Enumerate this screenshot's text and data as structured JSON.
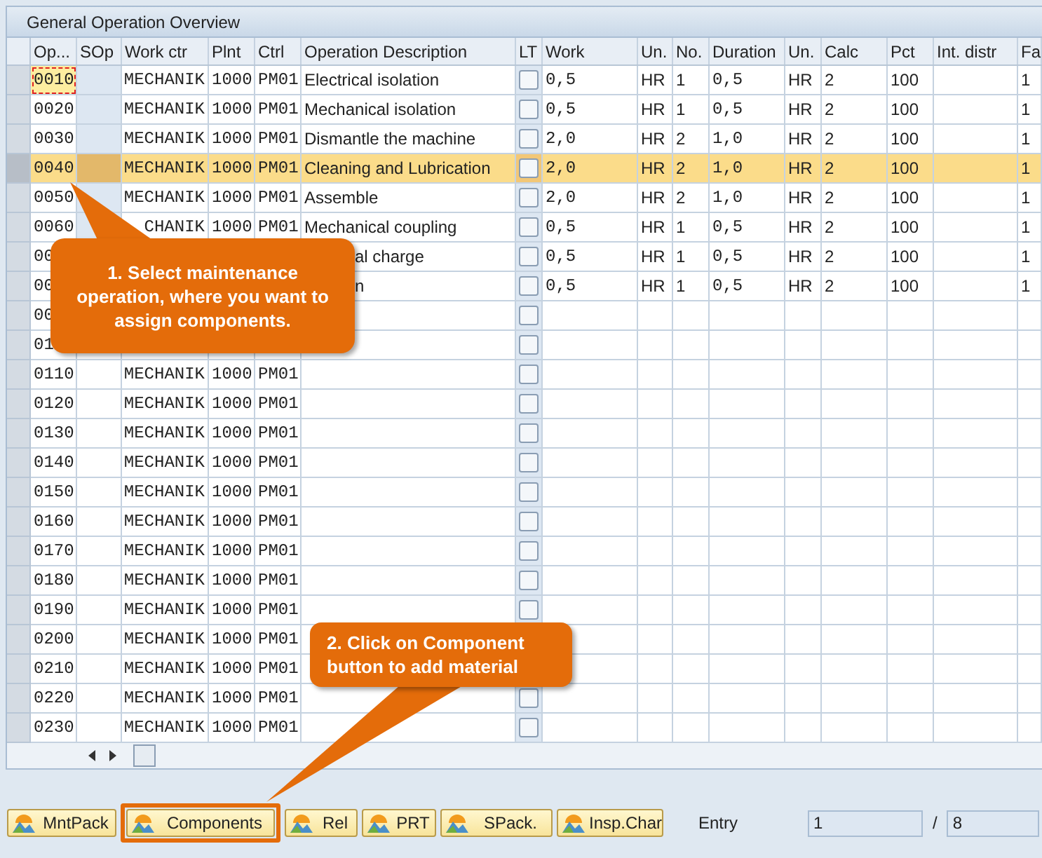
{
  "panel": {
    "title": "General Operation Overview"
  },
  "table": {
    "columns": [
      "Op...",
      "SOp",
      "Work ctr",
      "Plnt",
      "Ctrl",
      "Operation Description",
      "LT",
      "Work",
      "Un.",
      "No.",
      "Duration",
      "Un.",
      "Calc",
      "Pct",
      "Int. distr",
      "Fa"
    ],
    "rows": [
      {
        "selected": false,
        "focused": true,
        "covered": false,
        "lt_checked": false,
        "cells": [
          "0010",
          null,
          "MECHANIK",
          "1000",
          "PM01",
          "Electrical isolation",
          null,
          "0,5",
          "HR",
          "1",
          "0,5",
          "HR",
          "2",
          "100",
          null,
          "1"
        ]
      },
      {
        "selected": false,
        "focused": false,
        "covered": false,
        "lt_checked": false,
        "cells": [
          "0020",
          null,
          "MECHANIK",
          "1000",
          "PM01",
          "Mechanical isolation",
          null,
          "0,5",
          "HR",
          "1",
          "0,5",
          "HR",
          "2",
          "100",
          null,
          "1"
        ]
      },
      {
        "selected": false,
        "focused": false,
        "covered": false,
        "lt_checked": false,
        "cells": [
          "0030",
          null,
          "MECHANIK",
          "1000",
          "PM01",
          "Dismantle the machine",
          null,
          "2,0",
          "HR",
          "2",
          "1,0",
          "HR",
          "2",
          "100",
          null,
          "1"
        ]
      },
      {
        "selected": true,
        "focused": false,
        "covered": false,
        "lt_checked": false,
        "cells": [
          "0040",
          null,
          "MECHANIK",
          "1000",
          "PM01",
          "Cleaning and Lubrication",
          null,
          "2,0",
          "HR",
          "2",
          "1,0",
          "HR",
          "2",
          "100",
          null,
          "1"
        ]
      },
      {
        "selected": false,
        "focused": false,
        "covered": false,
        "lt_checked": false,
        "cells": [
          "0050",
          null,
          "MECHANIK",
          "1000",
          "PM01",
          "Assemble",
          null,
          "2,0",
          "HR",
          "2",
          "1,0",
          "HR",
          "2",
          "100",
          null,
          "1"
        ]
      },
      {
        "selected": false,
        "focused": false,
        "covered": false,
        "lt_checked": false,
        "cells": [
          "0060",
          null,
          "CHANIK",
          "1000",
          "PM01",
          "Mechanical coupling",
          null,
          "0,5",
          "HR",
          "1",
          "0,5",
          "HR",
          "2",
          "100",
          null,
          "1"
        ]
      },
      {
        "selected": false,
        "focused": false,
        "covered": true,
        "lt_checked": false,
        "cells": [
          "00",
          null,
          null,
          null,
          null,
          "al charge",
          null,
          "0,5",
          "HR",
          "1",
          "0,5",
          "HR",
          "2",
          "100",
          null,
          "1"
        ]
      },
      {
        "selected": false,
        "focused": false,
        "covered": true,
        "lt_checked": false,
        "cells": [
          "00",
          null,
          null,
          null,
          null,
          "n",
          null,
          "0,5",
          "HR",
          "1",
          "0,5",
          "HR",
          "2",
          "100",
          null,
          "1"
        ]
      },
      {
        "selected": false,
        "focused": false,
        "covered": false,
        "lt_checked": false,
        "cells": [
          "00",
          null,
          null,
          null,
          null,
          null,
          null,
          null,
          null,
          null,
          null,
          null,
          null,
          null,
          null,
          null
        ]
      },
      {
        "selected": false,
        "focused": false,
        "covered": false,
        "lt_checked": false,
        "cells": [
          "01",
          null,
          null,
          null,
          null,
          null,
          null,
          null,
          null,
          null,
          null,
          null,
          null,
          null,
          null,
          null
        ]
      },
      {
        "selected": false,
        "focused": false,
        "covered": false,
        "lt_checked": false,
        "cells": [
          "0110",
          null,
          "MECHANIK",
          "1000",
          "PM01",
          null,
          null,
          null,
          null,
          null,
          null,
          null,
          null,
          null,
          null,
          null
        ]
      },
      {
        "selected": false,
        "focused": false,
        "covered": false,
        "lt_checked": false,
        "cells": [
          "0120",
          null,
          "MECHANIK",
          "1000",
          "PM01",
          null,
          null,
          null,
          null,
          null,
          null,
          null,
          null,
          null,
          null,
          null
        ]
      },
      {
        "selected": false,
        "focused": false,
        "covered": false,
        "lt_checked": false,
        "cells": [
          "0130",
          null,
          "MECHANIK",
          "1000",
          "PM01",
          null,
          null,
          null,
          null,
          null,
          null,
          null,
          null,
          null,
          null,
          null
        ]
      },
      {
        "selected": false,
        "focused": false,
        "covered": false,
        "lt_checked": false,
        "cells": [
          "0140",
          null,
          "MECHANIK",
          "1000",
          "PM01",
          null,
          null,
          null,
          null,
          null,
          null,
          null,
          null,
          null,
          null,
          null
        ]
      },
      {
        "selected": false,
        "focused": false,
        "covered": false,
        "lt_checked": false,
        "cells": [
          "0150",
          null,
          "MECHANIK",
          "1000",
          "PM01",
          null,
          null,
          null,
          null,
          null,
          null,
          null,
          null,
          null,
          null,
          null
        ]
      },
      {
        "selected": false,
        "focused": false,
        "covered": false,
        "lt_checked": false,
        "cells": [
          "0160",
          null,
          "MECHANIK",
          "1000",
          "PM01",
          null,
          null,
          null,
          null,
          null,
          null,
          null,
          null,
          null,
          null,
          null
        ]
      },
      {
        "selected": false,
        "focused": false,
        "covered": false,
        "lt_checked": false,
        "cells": [
          "0170",
          null,
          "MECHANIK",
          "1000",
          "PM01",
          null,
          null,
          null,
          null,
          null,
          null,
          null,
          null,
          null,
          null,
          null
        ]
      },
      {
        "selected": false,
        "focused": false,
        "covered": false,
        "lt_checked": false,
        "cells": [
          "0180",
          null,
          "MECHANIK",
          "1000",
          "PM01",
          null,
          null,
          null,
          null,
          null,
          null,
          null,
          null,
          null,
          null,
          null
        ]
      },
      {
        "selected": false,
        "focused": false,
        "covered": false,
        "lt_checked": false,
        "cells": [
          "0190",
          null,
          "MECHANIK",
          "1000",
          "PM01",
          null,
          null,
          null,
          null,
          null,
          null,
          null,
          null,
          null,
          null,
          null
        ]
      },
      {
        "selected": false,
        "focused": false,
        "covered": false,
        "cells": [
          "0200",
          null,
          "MECHANIK",
          "1000",
          "PM01",
          null,
          null,
          null,
          null,
          null,
          null,
          null,
          null,
          null,
          null,
          null
        ]
      },
      {
        "selected": false,
        "focused": false,
        "covered": false,
        "cells": [
          "0210",
          null,
          "MECHANIK",
          "1000",
          "PM01",
          null,
          null,
          null,
          null,
          null,
          null,
          null,
          null,
          null,
          null,
          null
        ]
      },
      {
        "selected": false,
        "focused": false,
        "covered": false,
        "lt_checked": false,
        "cells": [
          "0220",
          null,
          "MECHANIK",
          "1000",
          "PM01",
          null,
          null,
          null,
          null,
          null,
          null,
          null,
          null,
          null,
          null,
          null
        ]
      },
      {
        "selected": false,
        "focused": false,
        "covered": false,
        "lt_checked": false,
        "cells": [
          "0230",
          null,
          "MECHANIK",
          "1000",
          "PM01",
          null,
          null,
          null,
          null,
          null,
          null,
          null,
          null,
          null,
          null,
          null
        ]
      }
    ]
  },
  "callouts": [
    "1. Select maintenance operation, where you want to assign components.",
    "2. Click on Component button to add material"
  ],
  "toolbar": {
    "buttons": [
      {
        "label": "MntPack",
        "highlighted": false
      },
      {
        "label": "Components",
        "highlighted": true
      },
      {
        "label": "Rel",
        "highlighted": false
      },
      {
        "label": "PRT",
        "highlighted": false
      },
      {
        "label": "SPack.",
        "highlighted": false
      },
      {
        "label": "Insp.Char",
        "highlighted": false
      }
    ],
    "entry_label": "Entry",
    "entry_value": "1",
    "separator": "/",
    "entry_total": "8"
  }
}
